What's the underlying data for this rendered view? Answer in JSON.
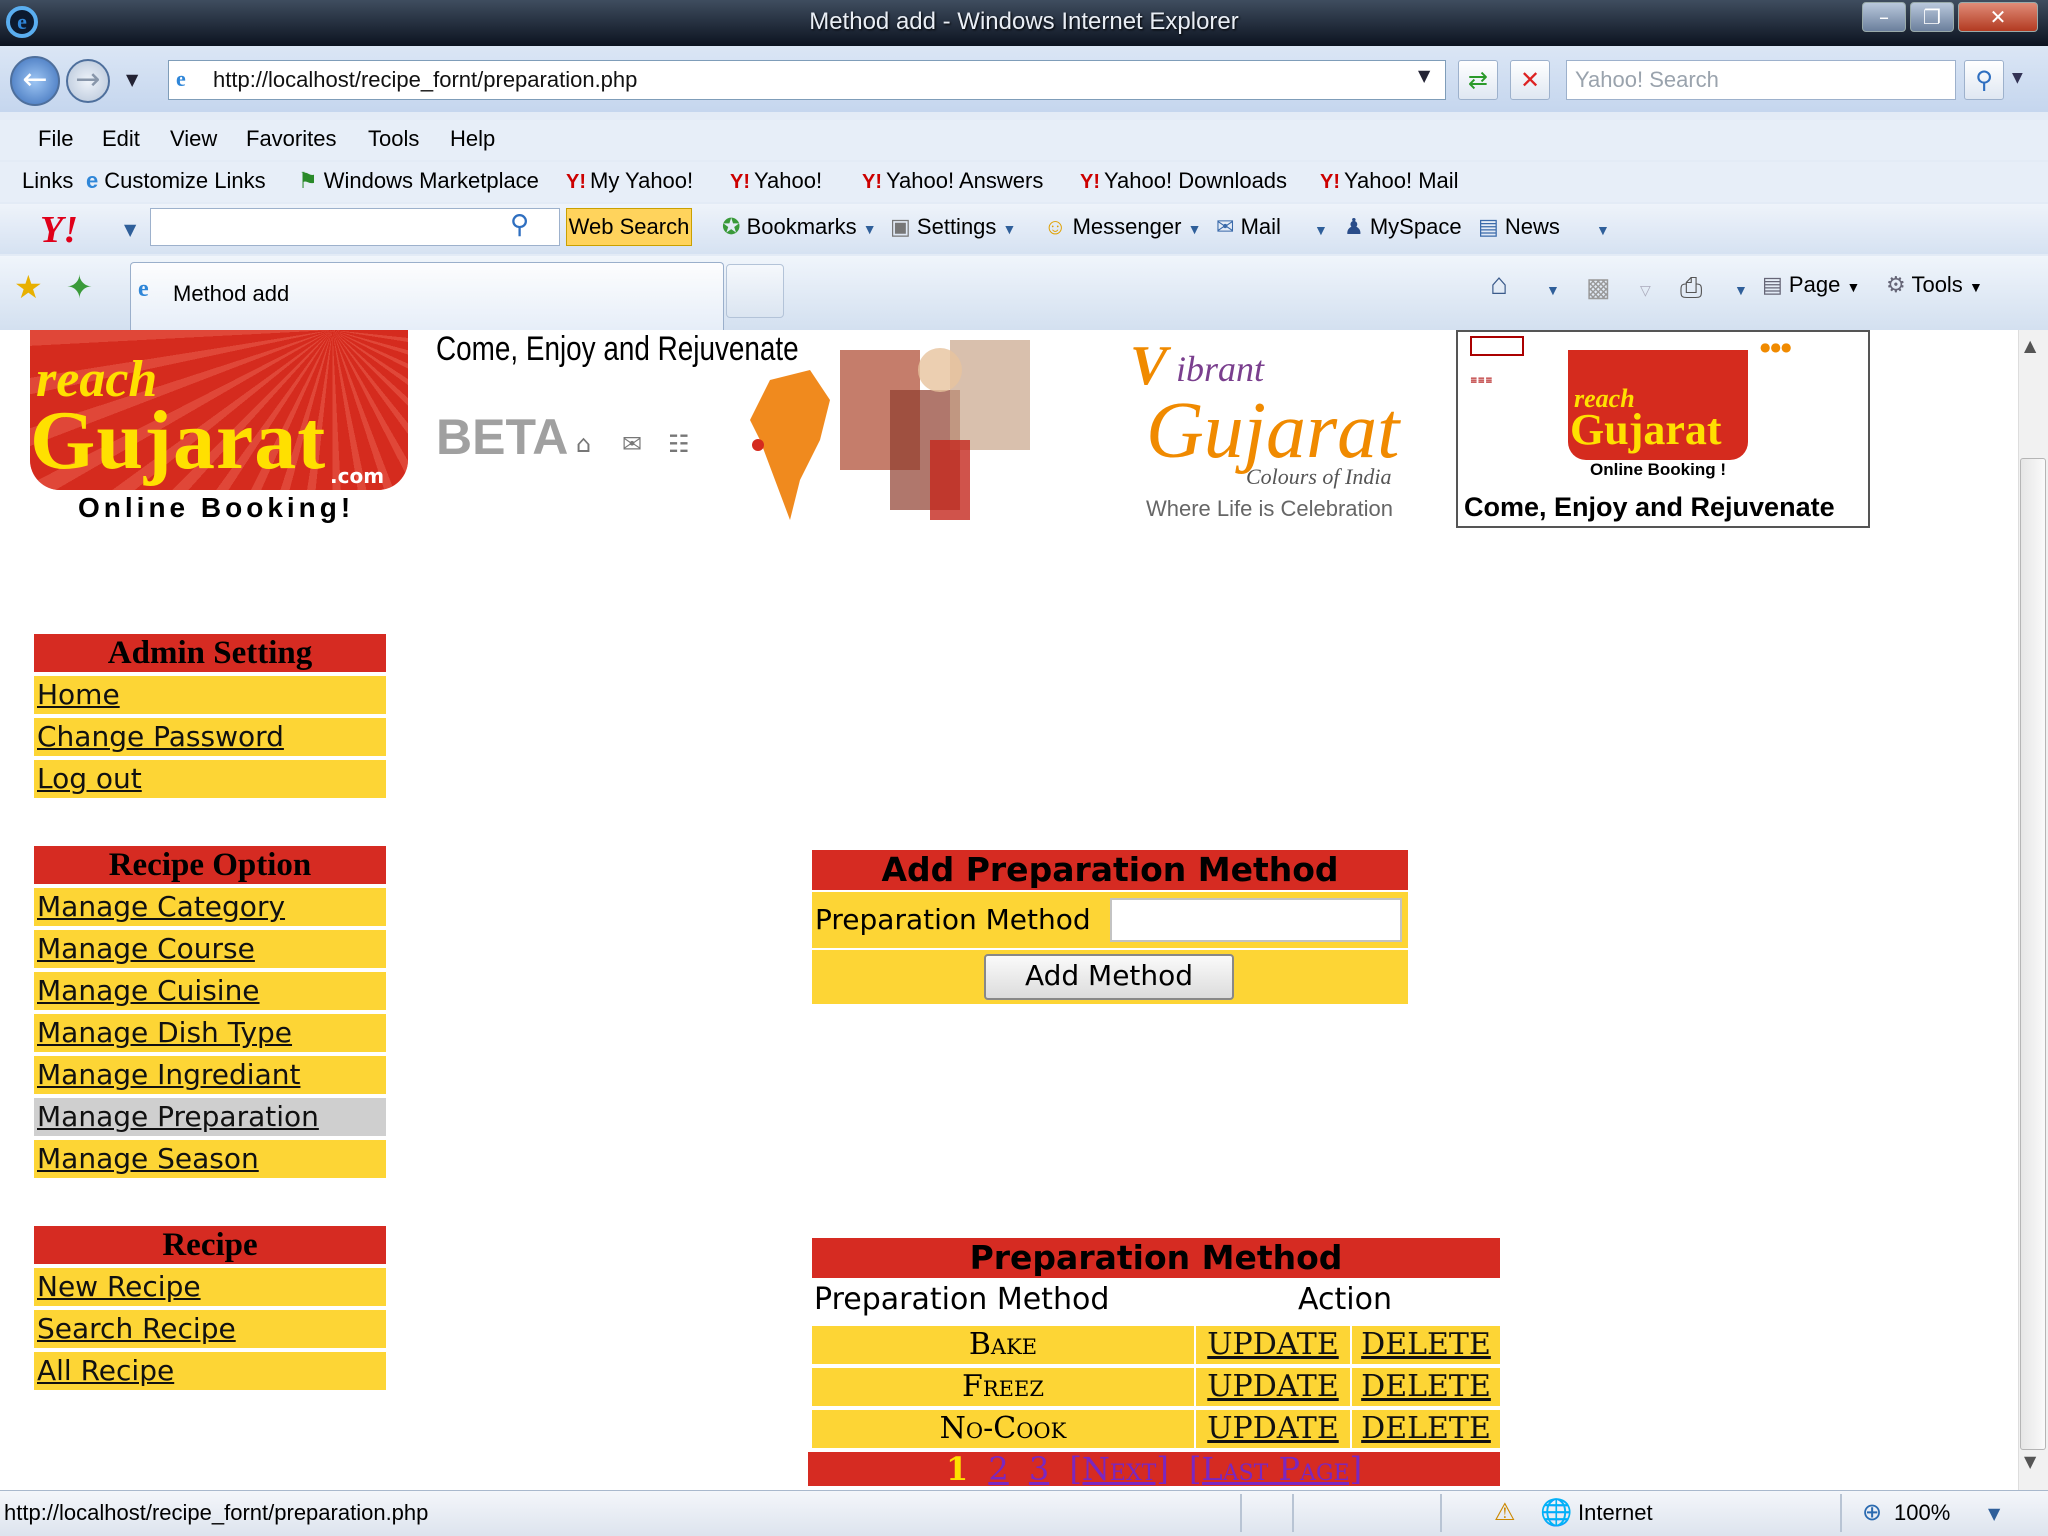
{
  "window": {
    "title": "Method add - Windows Internet Explorer",
    "minimize": "–",
    "restore": "❐",
    "close": "✕"
  },
  "nav": {
    "url": "http://localhost/recipe_fornt/preparation.php",
    "search_placeholder": "Yahoo! Search",
    "back_icon": "arrow-left-icon",
    "forward_icon": "arrow-right-icon"
  },
  "menu": [
    "File",
    "Edit",
    "View",
    "Favorites",
    "Tools",
    "Help"
  ],
  "links": {
    "label": "Links",
    "items": [
      "Customize Links",
      "Windows Marketplace",
      "My Yahoo!",
      "Yahoo!",
      "Yahoo! Answers",
      "Yahoo! Downloads",
      "Yahoo! Mail"
    ]
  },
  "yahoo_toolbar": {
    "logo": "Y!",
    "web_search": "Web Search",
    "bookmarks": "Bookmarks",
    "settings": "Settings",
    "messenger": "Messenger",
    "mail": "Mail",
    "myspace": "MySpace",
    "news": "News"
  },
  "tabs": {
    "active": "Method add"
  },
  "commandbar": {
    "page": "Page",
    "tools": "Tools"
  },
  "banner": {
    "logo_reach": "reach",
    "logo_gujarat": "Gujarat",
    "logo_com": ".com",
    "logo_tagline": "Online Booking!",
    "slogan": "Come, Enjoy and Rejuvenate",
    "beta": "BETA",
    "vibrant_v": "V",
    "vibrant_ibrant": "ibrant",
    "vibrant_gujarat": "Gujarat",
    "vibrant_colours": "Colours of India",
    "vibrant_life": "Where Life is Celebration",
    "ad_reach": "reach",
    "ad_gujarat": "Gujarat",
    "ad_online": "Online Booking !",
    "ad_come": "Come, Enjoy and Rejuvenate"
  },
  "sidebar": {
    "admin": {
      "title": "Admin Setting",
      "items": [
        "Home",
        "Change Password",
        "Log out"
      ]
    },
    "recipe_option": {
      "title": "Recipe Option",
      "items": [
        "Manage Category",
        "Manage Course",
        "Manage Cuisine",
        "Manage Dish Type",
        "Manage Ingrediant",
        "Manage Preparation",
        "Manage Season"
      ]
    },
    "recipe": {
      "title": "Recipe",
      "items": [
        "New Recipe",
        "Search Recipe",
        "All Recipe"
      ]
    }
  },
  "form": {
    "title": "Add Preparation Method",
    "label": "Preparation Method",
    "input_value": "",
    "button": "Add Method"
  },
  "table": {
    "title": "Preparation Method",
    "columns": [
      "Preparation Method",
      "Action"
    ],
    "rows": [
      {
        "name": "Bake",
        "update": "UPDATE",
        "delete": "DELETE"
      },
      {
        "name": "Freez",
        "update": "UPDATE",
        "delete": "DELETE"
      },
      {
        "name": "No-Cook",
        "update": "UPDATE",
        "delete": "DELETE"
      }
    ],
    "pager": {
      "current": "1",
      "pages": [
        "2",
        "3"
      ],
      "next": "[Next]",
      "last": "[Last Page]"
    }
  },
  "status": {
    "url": "http://localhost/recipe_fornt/preparation.php",
    "zone": "Internet",
    "zoom": "100%"
  }
}
